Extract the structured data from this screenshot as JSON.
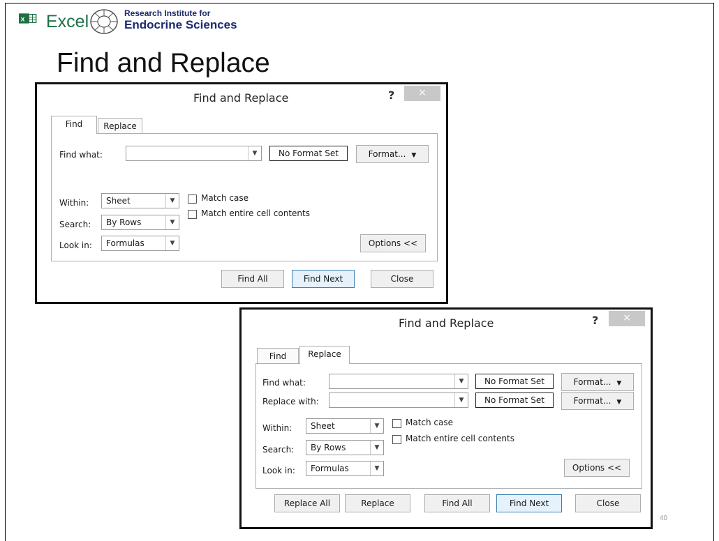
{
  "slide": {
    "title": "Find and Replace",
    "page_number": "40",
    "excel_label": "Excel",
    "institute_line1": "Research Institute for",
    "institute_line2": "Endocrine Sciences"
  },
  "icons": {
    "excel": "excel-icon",
    "seal": "institute-seal-icon",
    "close": "close-icon",
    "dropdown": "chevron-down-icon"
  },
  "colors": {
    "excel_green": "#1e7145",
    "default_button_border": "#3c7fb1",
    "close_button": "#c8c8c8"
  },
  "find_dialog": {
    "title": "Find and Replace",
    "help": "?",
    "close": "×",
    "tabs": [
      "Find",
      "Replace"
    ],
    "active_tab": "Find",
    "find_what_label": "Find what:",
    "find_what_value": "",
    "format_status": "No Format Set",
    "format_button": "Format...",
    "within_label": "Within:",
    "within_value": "Sheet",
    "search_label": "Search:",
    "search_value": "By Rows",
    "look_in_label": "Look in:",
    "look_in_value": "Formulas",
    "match_case": "Match case",
    "match_entire": "Match entire cell contents",
    "options_button": "Options <<",
    "find_all": "Find All",
    "find_next": "Find Next",
    "close_button": "Close"
  },
  "replace_dialog": {
    "title": "Find and Replace",
    "help": "?",
    "close": "×",
    "tabs": [
      "Find",
      "Replace"
    ],
    "active_tab": "Replace",
    "find_what_label": "Find what:",
    "find_what_value": "",
    "replace_with_label": "Replace with:",
    "replace_with_value": "",
    "format_status_find": "No Format Set",
    "format_status_replace": "No Format Set",
    "format_button_find": "Format...",
    "format_button_replace": "Format...",
    "within_label": "Within:",
    "within_value": "Sheet",
    "search_label": "Search:",
    "search_value": "By Rows",
    "look_in_label": "Look in:",
    "look_in_value": "Formulas",
    "match_case": "Match case",
    "match_entire": "Match entire cell contents",
    "options_button": "Options <<",
    "replace_all": "Replace All",
    "replace": "Replace",
    "find_all": "Find All",
    "find_next": "Find Next",
    "close_button": "Close"
  }
}
